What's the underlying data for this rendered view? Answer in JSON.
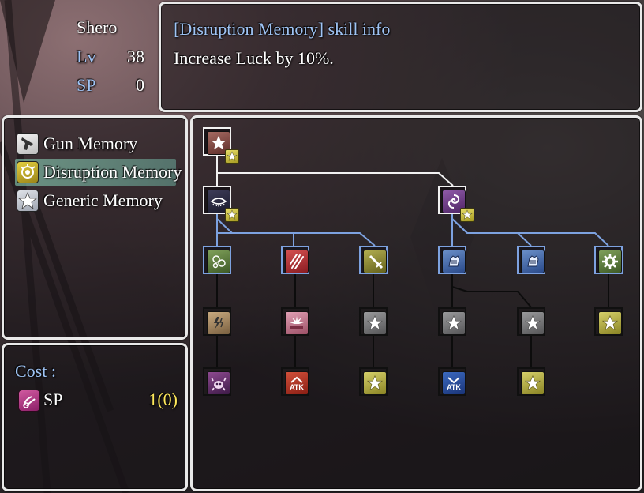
{
  "status": {
    "name": "Shero",
    "lv_label": "Lv",
    "lv_value": "38",
    "sp_label": "SP",
    "sp_value": "0"
  },
  "info": {
    "title": "[Disruption Memory] skill info",
    "description": "Increase Luck by 10%."
  },
  "categories": [
    {
      "label": "Gun Memory",
      "icon": "gun-icon",
      "selected": false
    },
    {
      "label": "Disruption Memory",
      "icon": "disruption-icon",
      "selected": true
    },
    {
      "label": "Generic Memory",
      "icon": "star-icon",
      "selected": false
    }
  ],
  "cost": {
    "label": "Cost :",
    "item_label": "SP",
    "item_value": "1(0)",
    "item_icon": "sp-card-icon"
  },
  "colors": {
    "info_title": "#9fc4f5",
    "cost_value": "#ffe95c",
    "selected_row": "#96e6c8",
    "unlocked_line": "#f2f2f2",
    "available_line": "#7da2e0"
  },
  "skill_tree": {
    "nodes": [
      {
        "id": "root",
        "icon": "star-icon",
        "state": "learned",
        "badge": "star-badge-icon"
      },
      {
        "id": "eye",
        "icon": "eye-icon",
        "state": "learned",
        "badge": "star-badge-icon"
      },
      {
        "id": "vortex",
        "icon": "vortex-icon",
        "state": "learned",
        "badge": "star-badge-icon"
      },
      {
        "id": "bubbles",
        "icon": "bubbles-icon",
        "state": "available"
      },
      {
        "id": "claw",
        "icon": "claw-icon",
        "state": "available"
      },
      {
        "id": "sword",
        "icon": "sword-icon",
        "state": "available"
      },
      {
        "id": "gauntlet-1",
        "icon": "gauntlet-icon",
        "state": "available"
      },
      {
        "id": "gauntlet-2",
        "icon": "gauntlet-icon",
        "state": "available"
      },
      {
        "id": "gear",
        "icon": "gear-icon",
        "state": "available"
      },
      {
        "id": "lightning",
        "icon": "lightning-icon",
        "state": "locked"
      },
      {
        "id": "burst",
        "icon": "burst-icon",
        "state": "locked"
      },
      {
        "id": "gray-star-1",
        "icon": "star-icon",
        "state": "locked"
      },
      {
        "id": "gray-star-2",
        "icon": "star-icon",
        "state": "locked"
      },
      {
        "id": "gray-star-3",
        "icon": "star-icon",
        "state": "locked"
      },
      {
        "id": "yellow-star-1",
        "icon": "star-icon",
        "state": "locked"
      },
      {
        "id": "crab",
        "icon": "crab-icon",
        "state": "locked"
      },
      {
        "id": "atk-up",
        "icon": "atk-up-icon",
        "label": "ATK",
        "state": "locked"
      },
      {
        "id": "yellow-star-2",
        "icon": "star-icon",
        "state": "locked"
      },
      {
        "id": "atk-down",
        "icon": "atk-down-icon",
        "label": "ATK",
        "state": "locked"
      },
      {
        "id": "yellow-star-3",
        "icon": "star-icon",
        "state": "locked"
      }
    ]
  }
}
